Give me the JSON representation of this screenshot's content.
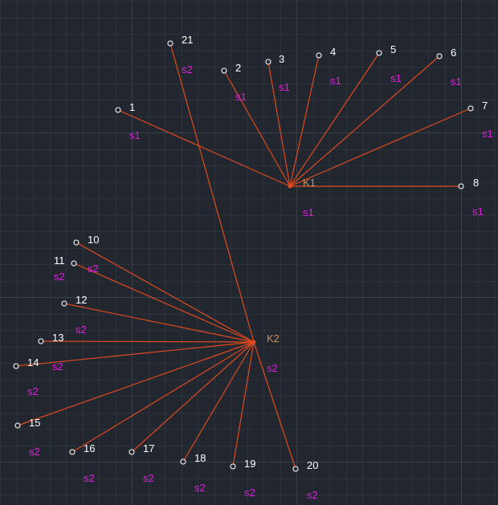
{
  "colors": {
    "background": "#22272f",
    "edge": "#e0491e",
    "node_label": "#ffffff",
    "group_label": "#e21ce2",
    "hub_label": "#c8905a"
  },
  "hubs": [
    {
      "id": "K1",
      "label": "K1"
    },
    {
      "id": "K2",
      "label": "K2"
    }
  ],
  "nodes": [
    {
      "id": "1",
      "label": "1",
      "group": "s1",
      "hub": "K1"
    },
    {
      "id": "2",
      "label": "2",
      "group": "s1",
      "hub": "K1"
    },
    {
      "id": "3",
      "label": "3",
      "group": "s1",
      "hub": "K1"
    },
    {
      "id": "4",
      "label": "4",
      "group": "s1",
      "hub": "K1"
    },
    {
      "id": "5",
      "label": "5",
      "group": "s1",
      "hub": "K1"
    },
    {
      "id": "6",
      "label": "6",
      "group": "s1",
      "hub": "K1"
    },
    {
      "id": "7",
      "label": "7",
      "group": "s1",
      "hub": "K1"
    },
    {
      "id": "8",
      "label": "8",
      "group": "s1",
      "hub": "K1"
    },
    {
      "id": "10",
      "label": "10",
      "group": "s2",
      "hub": "K2"
    },
    {
      "id": "11",
      "label": "11",
      "group": "s2",
      "hub": "K2"
    },
    {
      "id": "12",
      "label": "12",
      "group": "s2",
      "hub": "K2"
    },
    {
      "id": "13",
      "label": "13",
      "group": "s2",
      "hub": "K2"
    },
    {
      "id": "14",
      "label": "14",
      "group": "s2",
      "hub": "K2"
    },
    {
      "id": "15",
      "label": "15",
      "group": "s2",
      "hub": "K2"
    },
    {
      "id": "16",
      "label": "16",
      "group": "s2",
      "hub": "K2"
    },
    {
      "id": "17",
      "label": "17",
      "group": "s2",
      "hub": "K2"
    },
    {
      "id": "18",
      "label": "18",
      "group": "s2",
      "hub": "K2"
    },
    {
      "id": "19",
      "label": "19",
      "group": "s2",
      "hub": "K2"
    },
    {
      "id": "20",
      "label": "20",
      "group": "s2",
      "hub": "K2"
    },
    {
      "id": "21",
      "label": "21",
      "group": "s2",
      "hub": "K2"
    }
  ],
  "hub_group_labels": [
    {
      "hub": "K1",
      "text": "s1"
    },
    {
      "hub": "K2",
      "text": "s2"
    }
  ]
}
